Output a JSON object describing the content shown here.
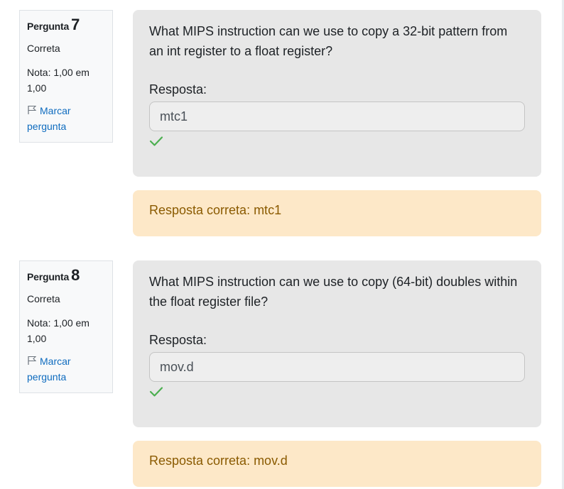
{
  "questions": [
    {
      "label": "Pergunta",
      "number": "7",
      "state": "Correta",
      "grade": "Nota: 1,00 em 1,00",
      "flag_label": "Marcar pergunta",
      "text": "What MIPS instruction can we use to copy a 32-bit pattern from an int register to a float register?",
      "answer_label": "Resposta:",
      "answer_value": "mtc1",
      "feedback": "Resposta correta: mtc1"
    },
    {
      "label": "Pergunta",
      "number": "8",
      "state": "Correta",
      "grade": "Nota: 1,00 em 1,00",
      "flag_label": "Marcar pergunta",
      "text": "What MIPS instruction can we use to copy (64-bit) doubles within the float register file?",
      "answer_label": "Resposta:",
      "answer_value": "mov.d",
      "feedback": "Resposta correta: mov.d"
    }
  ],
  "icons": {
    "flag": "flag-icon",
    "check": "check-icon"
  },
  "colors": {
    "link": "#0f6cbf",
    "correct": "#4caf50",
    "feedback_bg": "#fde8c8",
    "feedback_text": "#8a5a00",
    "content_bg": "#e7e7e7"
  }
}
